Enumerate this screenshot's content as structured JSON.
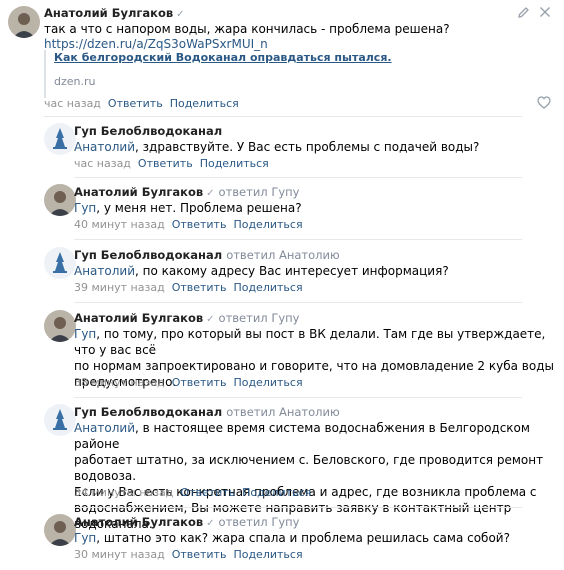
{
  "main_comment": {
    "author": "Анатолий Булгаков",
    "verified_icon": "check-icon",
    "text": "так а что с напором воды, жара кончилась - проблема решена?",
    "url": "https://dzen.ru/a/ZqS3oWaPSxrMUI_n",
    "link_card": {
      "title": "Как белгородский Водоканал оправдаться пытался.",
      "domain": "dzen.ru"
    },
    "time": "час назад",
    "reply_label": "Ответить",
    "share_label": "Поделиться"
  },
  "replies": [
    {
      "author": "Гуп Белоблводоканал",
      "reply_to": "",
      "mention": "Анатолий",
      "text": ", здравствуйте. У Вас есть проблемы с подачей воды?",
      "time": "час назад",
      "reply_label": "Ответить",
      "share_label": "Поделиться"
    },
    {
      "author": "Анатолий Булгаков",
      "reply_to": "ответил Гупу",
      "mention": "Гуп",
      "text": ", у меня нет. Проблема решена?",
      "time": "40 минут назад",
      "reply_label": "Ответить",
      "share_label": "Поделиться"
    },
    {
      "author": "Гуп Белоблводоканал",
      "reply_to": "ответил Анатолию",
      "mention": "Анатолий",
      "text": ", по какому адресу Вас интересует информация?",
      "time": "39 минут назад",
      "reply_label": "Ответить",
      "share_label": "Поделиться"
    },
    {
      "author": "Анатолий Булгаков",
      "reply_to": "ответил Гупу",
      "mention": "Гуп",
      "text_lines": [
        ", по тому, про который вы пост в ВК делали. Там где вы утверждаете, что у вас всё",
        "по нормам запроектировано и говорите, что на домовладение 2 куба воды",
        "предусмотрено."
      ],
      "time": "38 минут назад",
      "reply_label": "Ответить",
      "share_label": "Поделиться"
    },
    {
      "author": "Гуп Белоблводоканал",
      "reply_to": "ответил Анатолию",
      "mention": "Анатолий",
      "text_lines": [
        ", в настоящее время система водоснабжения в Белгородском районе",
        "работает штатно, за исключением с. Беловского, где проводится ремонт водовоза.",
        "Если у Вас есть конкретная проблема и адрес, где возникла проблема с",
        "водоснабжением, Вы можете направить заявку в контактный центр водоканала."
      ],
      "time": "34 минуты назад",
      "reply_label": "Ответить",
      "share_label": "Поделиться"
    },
    {
      "author": "Анатолий Булгаков",
      "reply_to": "ответил Гупу",
      "mention": "Гуп",
      "text": ", штатно это как? жара спала и проблема решилась сама собой?",
      "time": "30 минут назад",
      "reply_label": "Ответить",
      "share_label": "Поделиться"
    }
  ],
  "icons": {
    "edit": "pencil-icon",
    "close": "close-icon",
    "like": "heart-icon"
  },
  "colors": {
    "link": "#2a5885",
    "meta": "#939393",
    "divider": "#e7e8ec"
  }
}
